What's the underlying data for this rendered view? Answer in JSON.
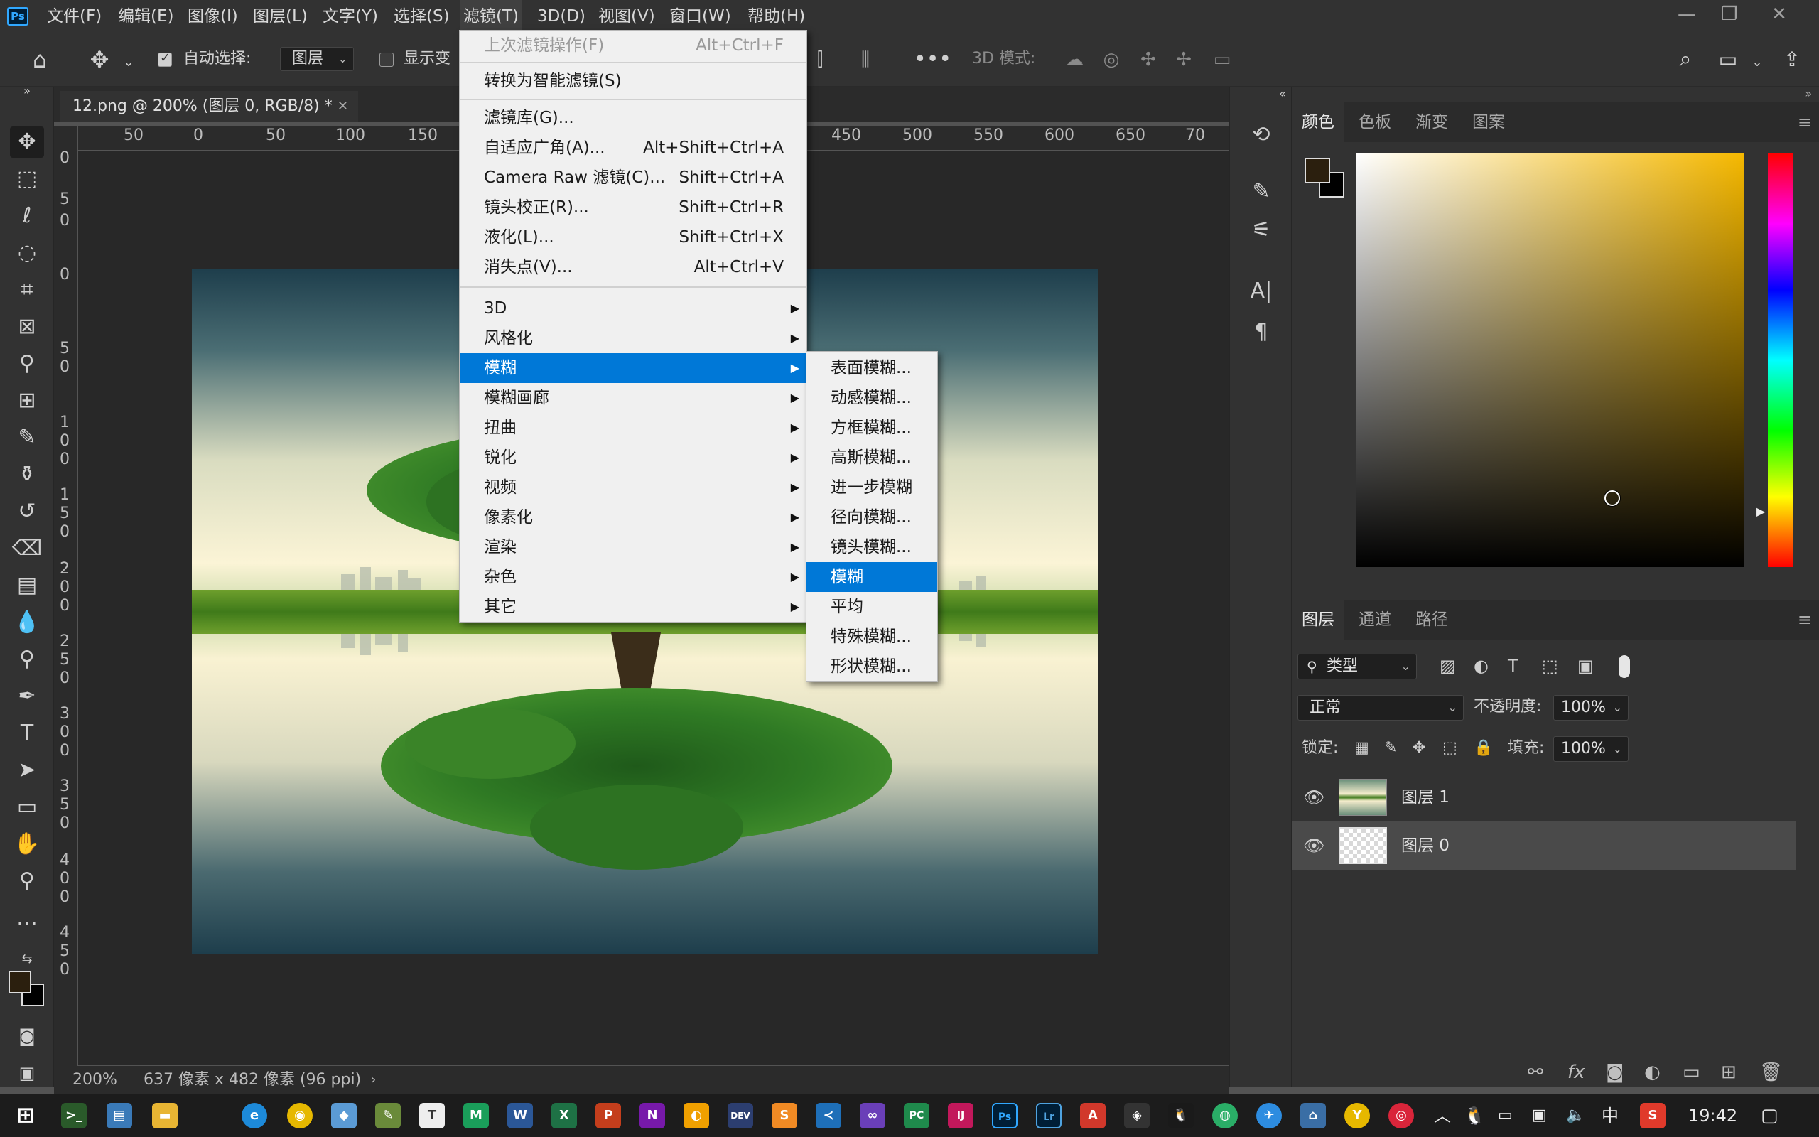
{
  "app": {
    "logo": "Ps",
    "menus": [
      "文件(F)",
      "编辑(E)",
      "图像(I)",
      "图层(L)",
      "文字(Y)",
      "选择(S)",
      "滤镜(T)",
      "3D(D)",
      "视图(V)",
      "窗口(W)",
      "帮助(H)"
    ],
    "active_menu": "滤镜(T)"
  },
  "options_bar": {
    "auto_select_label": "自动选择:",
    "auto_select_checked": true,
    "auto_select_target": "图层",
    "show_transform_label": "显示变",
    "mode_3d_label": "3D 模式:"
  },
  "document": {
    "tab_title": "12.png @ 200% (图层 0, RGB/8) *",
    "ruler_top_labels": [
      "50",
      "0",
      "50",
      "100",
      "150",
      "450",
      "500",
      "550",
      "600",
      "650",
      "70"
    ],
    "ruler_left_labels": [
      "0",
      "5",
      "0",
      "0",
      "5",
      "0",
      "1",
      "0",
      "0",
      "1",
      "5",
      "0",
      "2",
      "0",
      "0",
      "2",
      "5",
      "0",
      "3",
      "0",
      "0",
      "3",
      "5",
      "0",
      "4",
      "0",
      "0",
      "4",
      "5",
      "0"
    ],
    "zoom": "200%",
    "status": "637 像素 x 482 像素 (96 ppi)"
  },
  "filter_menu": {
    "items": [
      {
        "label": "上次滤镜操作(F)",
        "shortcut": "Alt+Ctrl+F",
        "disabled": true
      },
      {
        "label": "转换为智能滤镜(S)",
        "shortcut": ""
      },
      {
        "label": "滤镜库(G)...",
        "shortcut": ""
      },
      {
        "label": "自适应广角(A)...",
        "shortcut": "Alt+Shift+Ctrl+A"
      },
      {
        "label": "Camera Raw 滤镜(C)...",
        "shortcut": "Shift+Ctrl+A"
      },
      {
        "label": "镜头校正(R)...",
        "shortcut": "Shift+Ctrl+R"
      },
      {
        "label": "液化(L)...",
        "shortcut": "Shift+Ctrl+X"
      },
      {
        "label": "消失点(V)...",
        "shortcut": "Alt+Ctrl+V"
      },
      {
        "label": "3D",
        "submenu": true
      },
      {
        "label": "风格化",
        "submenu": true
      },
      {
        "label": "模糊",
        "submenu": true,
        "highlighted": true
      },
      {
        "label": "模糊画廊",
        "submenu": true
      },
      {
        "label": "扭曲",
        "submenu": true
      },
      {
        "label": "锐化",
        "submenu": true
      },
      {
        "label": "视频",
        "submenu": true
      },
      {
        "label": "像素化",
        "submenu": true
      },
      {
        "label": "渲染",
        "submenu": true
      },
      {
        "label": "杂色",
        "submenu": true
      },
      {
        "label": "其它",
        "submenu": true
      }
    ]
  },
  "blur_submenu": {
    "items": [
      "表面模糊...",
      "动感模糊...",
      "方框模糊...",
      "高斯模糊...",
      "进一步模糊",
      "径向模糊...",
      "镜头模糊...",
      "模糊",
      "平均",
      "特殊模糊...",
      "形状模糊..."
    ],
    "highlighted": "模糊"
  },
  "color_panel": {
    "tabs": [
      "颜色",
      "色板",
      "渐变",
      "图案"
    ],
    "active_tab": "颜色",
    "foreground": "#2b1f0e",
    "background": "#000000",
    "hue_color": "#f5b800"
  },
  "layers_panel": {
    "tabs": [
      "图层",
      "通道",
      "路径"
    ],
    "active_tab": "图层",
    "filter_kind": "类型",
    "blend_mode": "正常",
    "opacity_label": "不透明度:",
    "opacity": "100%",
    "lock_label": "锁定:",
    "fill_label": "填充:",
    "fill": "100%",
    "layers": [
      {
        "name": "图层 1",
        "visible": true,
        "selected": false
      },
      {
        "name": "图层 0",
        "visible": true,
        "selected": true
      }
    ]
  },
  "taskbar": {
    "apps": [
      "Terminal",
      "Files",
      "Explorer",
      "Edge",
      "Chrome",
      "Notes",
      "Tool",
      "Typora",
      "Mint",
      "Word",
      "Excel",
      "PowerPoint",
      "OneNote",
      "Pencil",
      "DevEco",
      "Sublime",
      "VS Code",
      "Visual Studio",
      "PyCharm",
      "IntelliJ",
      "Photoshop",
      "Lightroom",
      "Acrobat",
      "Game",
      "Penguin",
      "WeChat",
      "Feather",
      "Tray",
      "Cone",
      "Music"
    ],
    "ime": "中",
    "time": "19:42"
  }
}
